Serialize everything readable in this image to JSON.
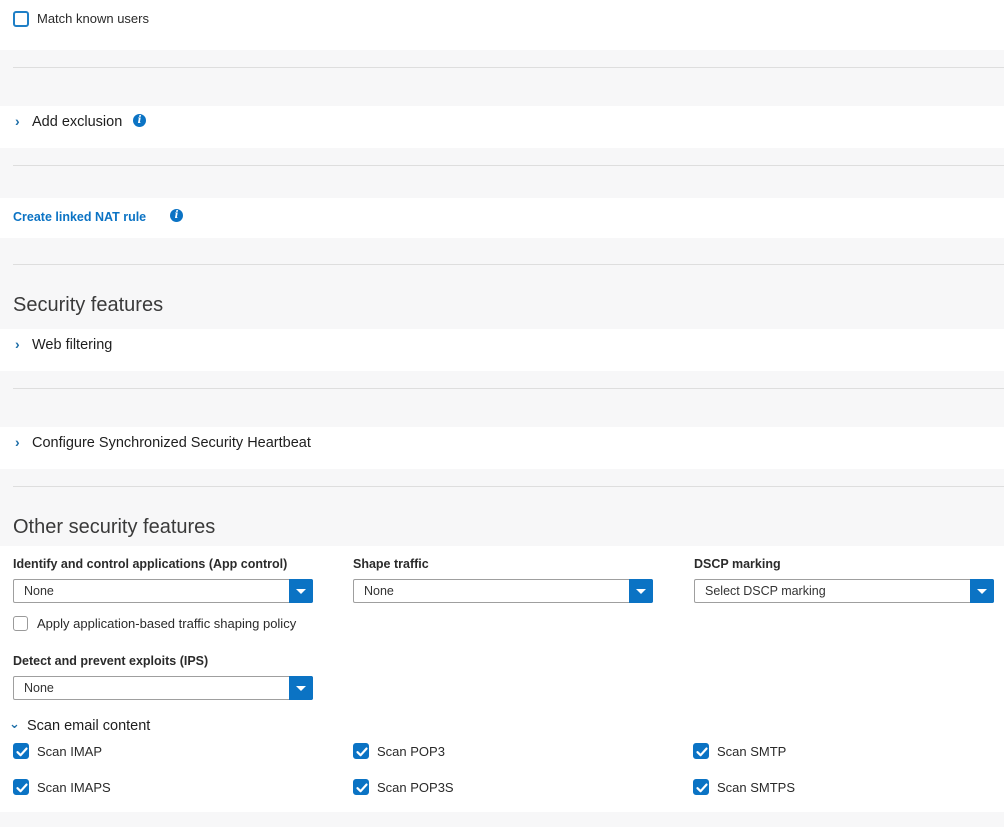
{
  "match_known_users": {
    "label": "Match known users",
    "checked": false
  },
  "add_exclusion": {
    "label": "Add exclusion",
    "info_icon": "info-icon"
  },
  "create_linked_nat": {
    "label": "Create linked NAT rule",
    "info_icon": "info-icon"
  },
  "security_features": {
    "title": "Security features",
    "web_filtering": "Web filtering",
    "heartbeat": "Configure Synchronized Security Heartbeat"
  },
  "other_security": {
    "title": "Other security features",
    "app_control": {
      "label": "Identify and control applications (App control)",
      "value": "None"
    },
    "shape_traffic": {
      "label": "Shape traffic",
      "value": "None"
    },
    "dscp": {
      "label": "DSCP marking",
      "value": "Select DSCP marking"
    },
    "apply_shaping": {
      "label": "Apply application-based traffic shaping policy",
      "checked": false
    },
    "ips": {
      "label": "Detect and prevent exploits (IPS)",
      "value": "None"
    },
    "scan_email": {
      "label": "Scan email content",
      "expanded": true,
      "options": [
        {
          "label": "Scan IMAP",
          "checked": true
        },
        {
          "label": "Scan POP3",
          "checked": true
        },
        {
          "label": "Scan SMTP",
          "checked": true
        },
        {
          "label": "Scan IMAPS",
          "checked": true
        },
        {
          "label": "Scan POP3S",
          "checked": true
        },
        {
          "label": "Scan SMTPS",
          "checked": true
        }
      ]
    }
  },
  "colors": {
    "accent": "#0b73c4",
    "page_bg": "#f7f7f8",
    "band_bg": "#ffffff"
  }
}
